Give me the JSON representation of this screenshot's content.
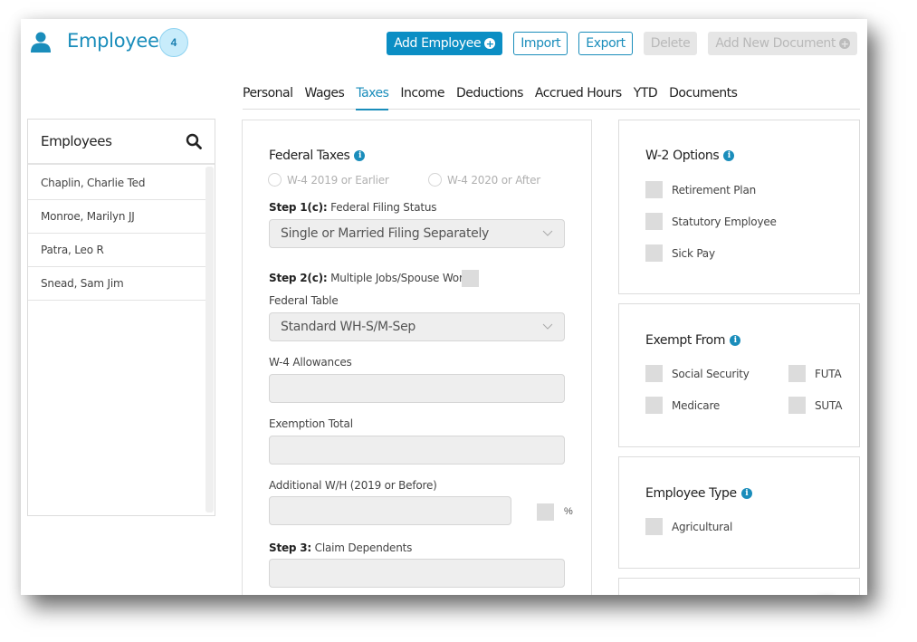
{
  "header": {
    "title": "Employees",
    "count": "4",
    "icon": "user-icon"
  },
  "toolbar": {
    "add_employee": "Add Employee",
    "import": "Import",
    "export": "Export",
    "delete": "Delete",
    "add_document": "Add New Document",
    "plus_glyph": "+"
  },
  "tabs": [
    {
      "label": "Personal",
      "active": false
    },
    {
      "label": "Wages",
      "active": false
    },
    {
      "label": "Taxes",
      "active": true
    },
    {
      "label": "Income",
      "active": false
    },
    {
      "label": "Deductions",
      "active": false
    },
    {
      "label": "Accrued Hours",
      "active": false
    },
    {
      "label": "YTD",
      "active": false
    },
    {
      "label": "Documents",
      "active": false
    }
  ],
  "employees_panel": {
    "title": "Employees",
    "items": [
      "Chaplin, Charlie Ted",
      "Monroe, Marilyn JJ",
      "Patra, Leo R",
      "Snead, Sam Jim"
    ]
  },
  "federal": {
    "title": "Federal Taxes",
    "info_glyph": "i",
    "radio_w4_2019": "W-4 2019 or Earlier",
    "radio_w4_2020": "W-4 2020 or After",
    "step1_prefix": "Step 1(c):",
    "step1_label": " Federal Filing Status",
    "filing_status_value": "Single or Married Filing Separately",
    "step2_prefix": "Step 2(c):",
    "step2_label": " Multiple Jobs/Spouse Works",
    "federal_table_label": "Federal Table",
    "federal_table_value": "Standard WH-S/M-Sep",
    "allowances_label": "W-4 Allowances",
    "allowances_value": "",
    "exemption_label": "Exemption Total",
    "exemption_value": "",
    "additional_label": "Additional W/H (2019 or Before)",
    "additional_value": "",
    "percent_symbol": "%",
    "step3_prefix": "Step 3:",
    "step3_label": " Claim Dependents",
    "step3_value": ""
  },
  "w2_options": {
    "title": "W-2 Options",
    "items": [
      "Retirement Plan",
      "Statutory Employee",
      "Sick Pay"
    ]
  },
  "exempt_from": {
    "title": "Exempt From",
    "left": [
      "Social Security",
      "Medicare"
    ],
    "right": [
      "FUTA",
      "SUTA"
    ]
  },
  "employee_type": {
    "title": "Employee Type",
    "items": [
      "Agricultural"
    ]
  },
  "colors": {
    "accent": "#1a8dbb",
    "primary_button": "#0b8ec4",
    "badge_bg": "#c8ecfb",
    "disabled": "#e6e6e6",
    "field_bg": "#eeeeee"
  }
}
